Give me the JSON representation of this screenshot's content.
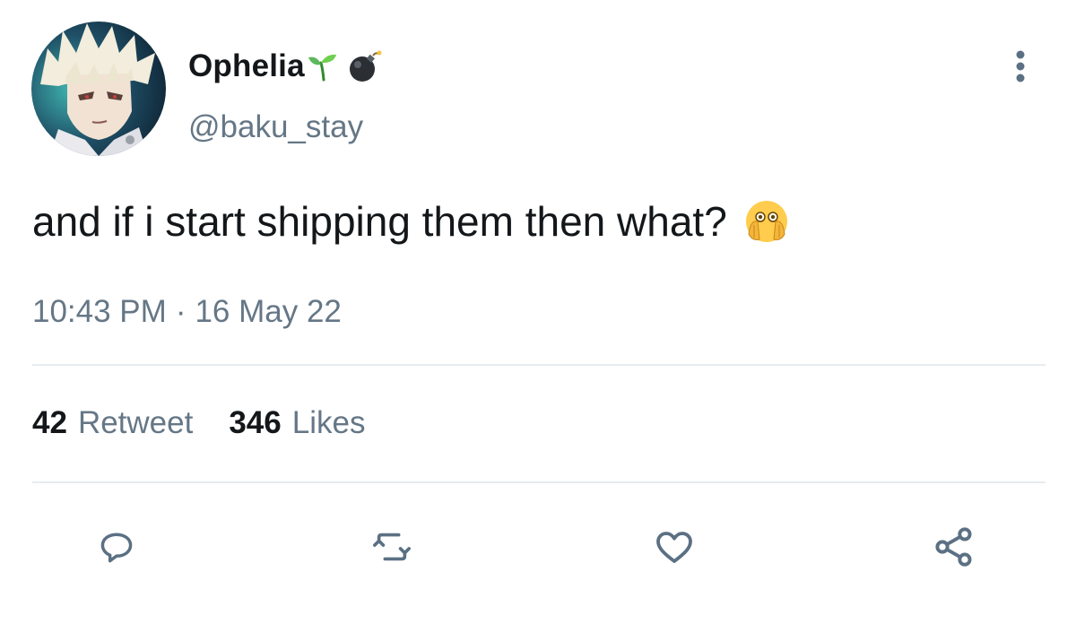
{
  "author": {
    "display_name": "Ophelia",
    "handle": "@baku_stay",
    "name_emojis": [
      "seedling-emoji",
      "bomb-emoji"
    ],
    "avatar": "anime-avatar"
  },
  "tweet": {
    "text": "and if i start shipping them then what?",
    "text_emoji": "face-with-open-eyes-and-hand-over-mouth-emoji",
    "time": "10:43 PM",
    "separator": "·",
    "date": "16 May 22"
  },
  "stats": {
    "retweets_count": "42",
    "retweets_label": "Retweet",
    "likes_count": "346",
    "likes_label": "Likes"
  },
  "actions": [
    "reply-icon",
    "retweet-icon",
    "like-icon",
    "share-icon"
  ],
  "colors": {
    "text": "#14171a",
    "secondary": "#657786",
    "icon": "#5b7083",
    "divider": "#e6ecf0"
  }
}
